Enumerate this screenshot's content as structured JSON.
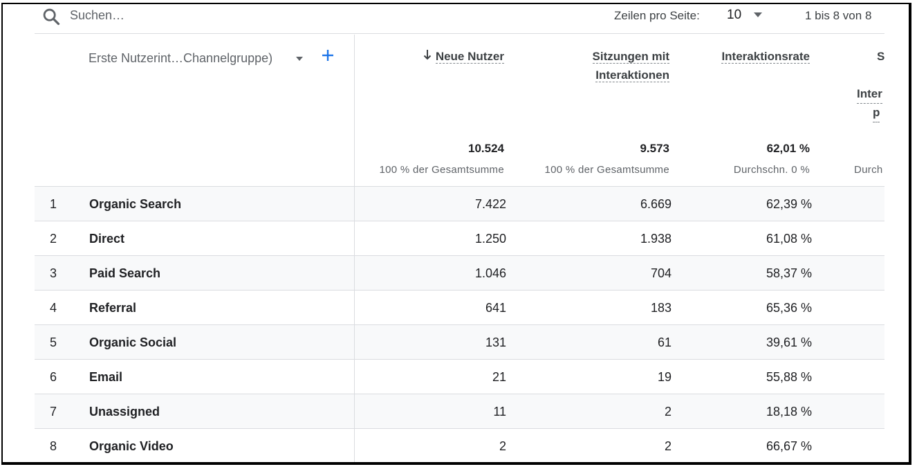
{
  "toolbar": {
    "search_placeholder": "Suchen…",
    "rows_per_page_label": "Zeilen pro Seite:",
    "rows_per_page_value": "10",
    "range": "1 bis 8 von 8"
  },
  "table": {
    "dimension_header": "Erste Nutzerint…Channelgruppe)",
    "columns": [
      {
        "label_line1": "Neue Nutzer",
        "label_line2": "",
        "sorted": true,
        "total": "10.524",
        "total_sub": "100 % der Gesamtsumme"
      },
      {
        "label_line1": "Sitzungen mit",
        "label_line2": "Interaktionen",
        "sorted": false,
        "total": "9.573",
        "total_sub": "100 % der Gesamtsumme"
      },
      {
        "label_line1": "Interaktionsrate",
        "label_line2": "",
        "sorted": false,
        "total": "62,01 %",
        "total_sub": "Durchschn. 0 %"
      },
      {
        "label_line1": "S",
        "label_line2": "Inter",
        "label_line3": "p",
        "total_sub": "Durch"
      }
    ],
    "rows": [
      {
        "index": "1",
        "name": "Organic Search",
        "c1": "7.422",
        "c2": "6.669",
        "c3": "62,39 %"
      },
      {
        "index": "2",
        "name": "Direct",
        "c1": "1.250",
        "c2": "1.938",
        "c3": "61,08 %"
      },
      {
        "index": "3",
        "name": "Paid Search",
        "c1": "1.046",
        "c2": "704",
        "c3": "58,37 %"
      },
      {
        "index": "4",
        "name": "Referral",
        "c1": "641",
        "c2": "183",
        "c3": "65,36 %"
      },
      {
        "index": "5",
        "name": "Organic Social",
        "c1": "131",
        "c2": "61",
        "c3": "39,61 %"
      },
      {
        "index": "6",
        "name": "Email",
        "c1": "21",
        "c2": "19",
        "c3": "55,88 %"
      },
      {
        "index": "7",
        "name": "Unassigned",
        "c1": "11",
        "c2": "2",
        "c3": "18,18 %"
      },
      {
        "index": "8",
        "name": "Organic Video",
        "c1": "2",
        "c2": "2",
        "c3": "66,67 %"
      }
    ]
  },
  "colors": {
    "accent": "#1a73e8",
    "shaded_row": "#f8f9fa",
    "border": "#dadce0"
  },
  "icons": {
    "search": "search-icon",
    "sort": "arrow-down-icon",
    "add": "plus-icon",
    "dropdown": "caret-down-icon"
  }
}
